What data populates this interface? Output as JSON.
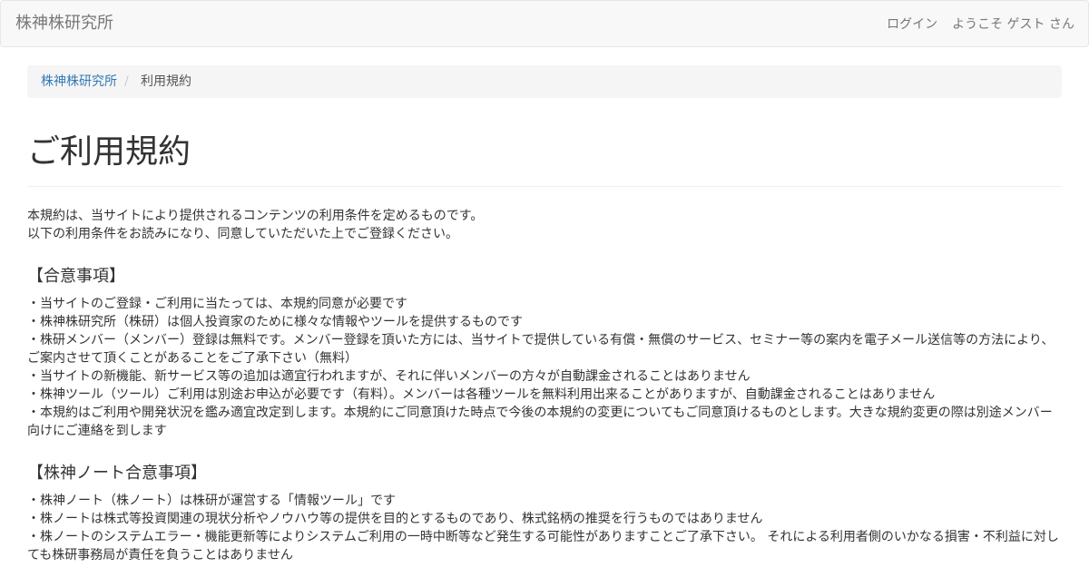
{
  "navbar": {
    "brand": "株神株研究所",
    "links": [
      "ログイン",
      "ようこそ ゲスト さん"
    ]
  },
  "breadcrumb": {
    "home": "株神株研究所",
    "separator": "/",
    "current": "利用規約"
  },
  "page": {
    "title": "ご利用規約",
    "intro": [
      "本規約は、当サイトにより提供されるコンテンツの利用条件を定めるものです。",
      "以下の利用条件をお読みになり、同意していただいた上でご登録ください。"
    ]
  },
  "sections": [
    {
      "heading": "【合意事項】",
      "items": [
        "・当サイトのご登録・ご利用に当たっては、本規約同意が必要です",
        "・株神株研究所（株研）は個人投資家のために様々な情報やツールを提供するものです",
        "・株研メンバー（メンバー）登録は無料です。メンバー登録を頂いた方には、当サイトで提供している有償・無償のサービス、セミナー等の案内を電子メール送信等の方法により、ご案内させて頂くことがあることをご了承下さい（無料）",
        "・当サイトの新機能、新サービス等の追加は適宜行われますが、それに伴いメンバーの方々が自動課金されることはありません",
        "・株神ツール（ツール）ご利用は別途お申込が必要です（有料）。メンバーは各種ツールを無料利用出来ることがありますが、自動課金されることはありません",
        "・本規約はご利用や開発状況を鑑み適宜改定到します。本規約にご同意頂けた時点で今後の本規約の変更についてもご同意頂けるものとします。大きな規約変更の際は別途メンバー向けにご連絡を到します"
      ]
    },
    {
      "heading": "【株神ノート合意事項】",
      "items": [
        "・株神ノート（株ノート）は株研が運営する「情報ツール」です",
        "・株ノートは株式等投資関連の現状分析やノウハウ等の提供を目的とするものであり、株式銘柄の推奨を行うものではありません",
        "・株ノートのシステムエラー・機能更新等によりシステムご利用の一時中断等など発生する可能性がありますことご了承下さい。 それによる利用者側のいかなる損害・不利益に対しても株研事務局が責任を負うことはありません"
      ]
    }
  ]
}
